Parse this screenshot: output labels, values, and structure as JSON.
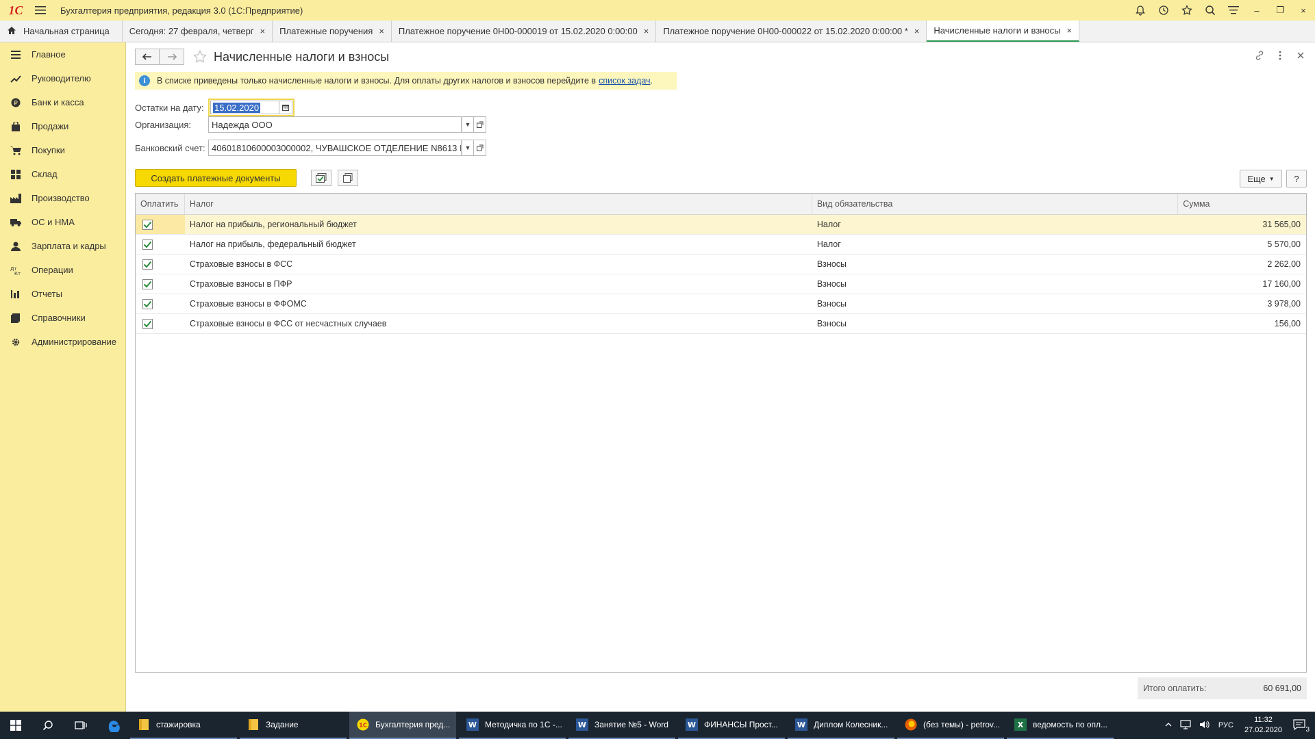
{
  "window": {
    "title": "Бухгалтерия предприятия, редакция 3.0 (1С:Предприятие)",
    "logo": "1С",
    "controls": {
      "minimize": "–",
      "restore": "❐",
      "close": "×"
    }
  },
  "tabs": [
    {
      "label": "Начальная страница",
      "icon": "home-icon"
    },
    {
      "label": "Сегодня: 27 февраля, четверг",
      "close": "×"
    },
    {
      "label": "Платежные поручения",
      "close": "×"
    },
    {
      "label": "Платежное поручение 0Н00-000019 от 15.02.2020 0:00:00",
      "close": "×"
    },
    {
      "label": "Платежное поручение 0Н00-000022 от 15.02.2020 0:00:00 *",
      "close": "×"
    },
    {
      "label": "Начисленные налоги и взносы",
      "close": "×",
      "active": true
    }
  ],
  "sidebar": {
    "items": [
      {
        "label": "Главное",
        "icon": "menu-lines-icon"
      },
      {
        "label": "Руководителю",
        "icon": "trend-icon"
      },
      {
        "label": "Банк и касса",
        "icon": "coin-icon"
      },
      {
        "label": "Продажи",
        "icon": "bag-icon"
      },
      {
        "label": "Покупки",
        "icon": "cart-icon"
      },
      {
        "label": "Склад",
        "icon": "warehouse-icon"
      },
      {
        "label": "Производство",
        "icon": "factory-icon"
      },
      {
        "label": "ОС и НМА",
        "icon": "truck-icon"
      },
      {
        "label": "Зарплата и кадры",
        "icon": "person-icon"
      },
      {
        "label": "Операции",
        "icon": "operations-icon"
      },
      {
        "label": "Отчеты",
        "icon": "bar-chart-icon"
      },
      {
        "label": "Справочники",
        "icon": "book-icon"
      },
      {
        "label": "Администрирование",
        "icon": "gear-icon"
      }
    ]
  },
  "form": {
    "title": "Начисленные налоги и взносы",
    "info_text": "В списке приведены только начисленные налоги и взносы. Для оплаты других налогов и взносов перейдите в",
    "info_link": "список задач",
    "info_end": ".",
    "date_label": "Остатки на дату:",
    "date_value": "15.02.2020",
    "org_label": "Организация:",
    "org_value": "Надежда ООО",
    "bank_label": "Банковский счет:",
    "bank_value": "40601810600003000002, ЧУВАШСКОЕ ОТДЕЛЕНИЕ N8613 I",
    "create_button": "Создать платежные документы",
    "more_button": "Еще",
    "help_button": "?"
  },
  "table": {
    "headers": [
      "Оплатить",
      "Налог",
      "Вид обязательства",
      "Сумма"
    ],
    "rows": [
      {
        "tax": "Налог на прибыль, региональный бюджет",
        "kind": "Налог",
        "sum": "31 565,00"
      },
      {
        "tax": "Налог на прибыль, федеральный бюджет",
        "kind": "Налог",
        "sum": "5 570,00"
      },
      {
        "tax": "Страховые взносы в ФСС",
        "kind": "Взносы",
        "sum": "2 262,00"
      },
      {
        "tax": "Страховые взносы в ПФР",
        "kind": "Взносы",
        "sum": "17 160,00"
      },
      {
        "tax": "Страховые взносы в ФФОМС",
        "kind": "Взносы",
        "sum": "3 978,00"
      },
      {
        "tax": "Страховые взносы в ФСС от несчастных случаев",
        "kind": "Взносы",
        "sum": "156,00"
      }
    ]
  },
  "total": {
    "label": "Итого оплатить:",
    "value": "60 691,00"
  },
  "taskbar": {
    "apps": [
      {
        "label": "стажировка",
        "icon": "folder-icon"
      },
      {
        "label": "Задание",
        "icon": "folder-icon"
      },
      {
        "label": "Бухгалтерия пред...",
        "icon": "1c-icon",
        "active": true
      },
      {
        "label": "Методичка по 1С -...",
        "icon": "word-icon"
      },
      {
        "label": "Занятие №5 - Word",
        "icon": "word-icon"
      },
      {
        "label": "ФИНАНСЫ Прост...",
        "icon": "word-icon"
      },
      {
        "label": "Диплом Колесник...",
        "icon": "word-icon"
      },
      {
        "label": "(без темы) - petrov...",
        "icon": "firefox-icon"
      },
      {
        "label": "ведомость по опл...",
        "icon": "excel-icon"
      }
    ],
    "lang": "РУС",
    "time": "11:32",
    "date": "27.02.2020",
    "notifications": "3"
  }
}
